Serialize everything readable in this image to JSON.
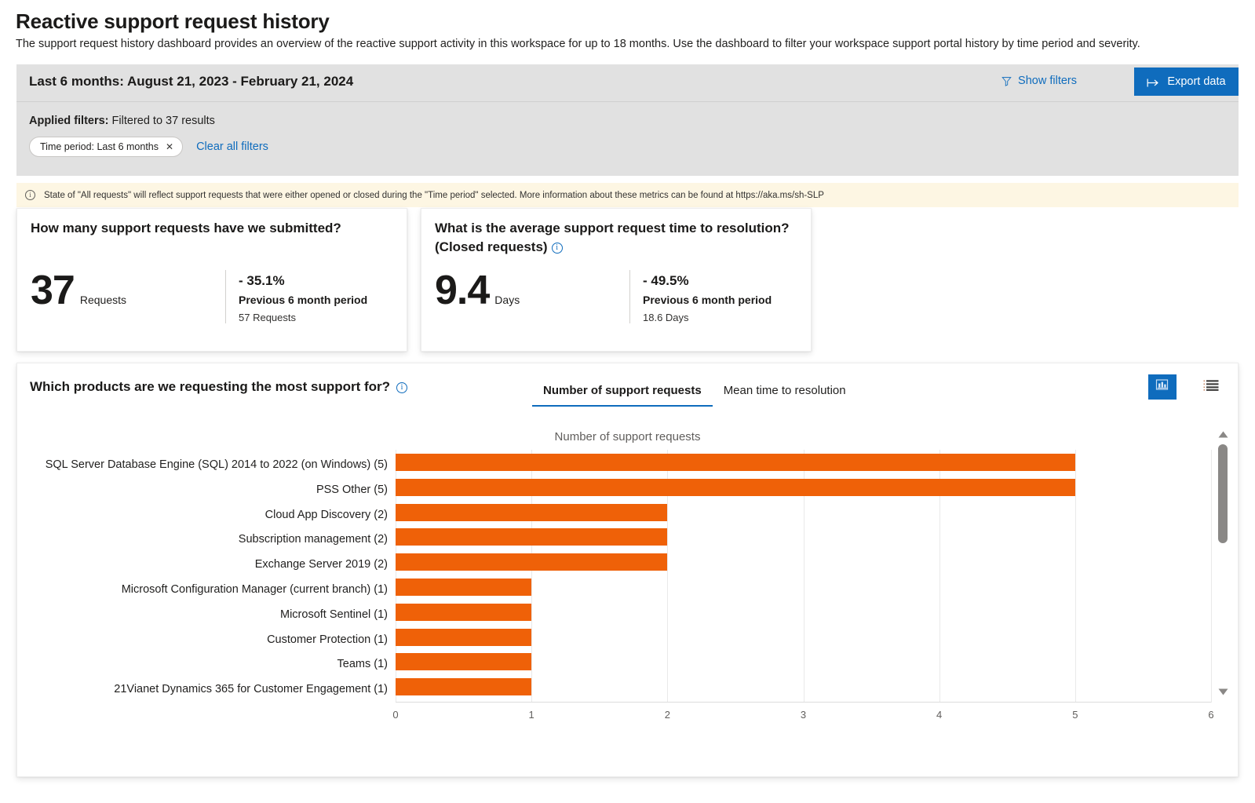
{
  "page": {
    "title": "Reactive support request history",
    "description": "The support request history dashboard provides an overview of the reactive support activity in this workspace for up to 18 months. Use the dashboard to filter your workspace support portal history by time period and severity."
  },
  "filter_bar": {
    "range_title": "Last 6 months: August 21, 2023 - February 21, 2024",
    "show_filters_label": "Show filters",
    "show_filters_icon": "funnel-icon",
    "export_label": "Export data",
    "export_icon": "export-arrow-icon",
    "applied_label": "Applied filters:",
    "applied_summary": "Filtered to 37 results",
    "chips": [
      {
        "label": "Time period: Last 6 months",
        "remove_icon": "close-icon"
      }
    ],
    "clear_all_label": "Clear all filters"
  },
  "info_banner": {
    "icon": "info-icon",
    "text": "State of \"All requests\" will reflect support requests that were either opened or closed during the \"Time period\" selected. More information about these metrics can be found at https://aka.ms/sh-SLP"
  },
  "kpis": [
    {
      "question": "How many support requests have we submitted?",
      "has_info_icon": false,
      "value": "37",
      "unit": "Requests",
      "delta": "- 35.1%",
      "previous_label": "Previous 6 month period",
      "previous_value": "57 Requests"
    },
    {
      "question": "What is the average support request time to resolution?(Closed requests)",
      "has_info_icon": true,
      "info_icon": "info-icon",
      "value": "9.4",
      "unit": "Days",
      "delta": "- 49.5%",
      "previous_label": "Previous 6 month period",
      "previous_value": "18.6 Days"
    }
  ],
  "chart_panel": {
    "question": "Which products are we requesting the most support for?",
    "info_icon": "info-icon",
    "tabs": [
      {
        "label": "Number of support requests",
        "active": true
      },
      {
        "label": "Mean time to resolution",
        "active": false
      }
    ],
    "view_toggle": [
      {
        "name": "chart-view",
        "icon": "bar-chart-icon",
        "active": true
      },
      {
        "name": "list-view",
        "icon": "list-view-icon",
        "active": false
      }
    ],
    "scrollbar": {
      "up_icon": "chevron-up-icon",
      "down_icon": "chevron-down-icon"
    }
  },
  "chart_data": {
    "type": "bar",
    "orientation": "horizontal",
    "title": "Number of support requests",
    "xlabel": "",
    "ylabel": "",
    "xlim": [
      0,
      6
    ],
    "xticks": [
      "0",
      "1",
      "2",
      "3",
      "4",
      "5",
      "6"
    ],
    "grid": true,
    "legend": false,
    "bar_color": "#ef6108",
    "categories": [
      "SQL Server  Database Engine (SQL)  2014 to 2022 (on Windows) (5)",
      "PSS Other (5)",
      "Cloud App Discovery (2)",
      "Subscription management (2)",
      "Exchange Server 2019 (2)",
      "Microsoft Configuration Manager (current branch) (1)",
      "Microsoft Sentinel (1)",
      "Customer Protection (1)",
      "Teams (1)",
      "21Vianet Dynamics 365 for Customer Engagement (1)"
    ],
    "values": [
      5,
      5,
      2,
      2,
      2,
      1,
      1,
      1,
      1,
      1
    ]
  },
  "colors": {
    "accent": "#0f6cbd",
    "bar": "#ef6108",
    "banner_bg": "#fdf6e3",
    "filter_bg": "#e1e1e1"
  }
}
